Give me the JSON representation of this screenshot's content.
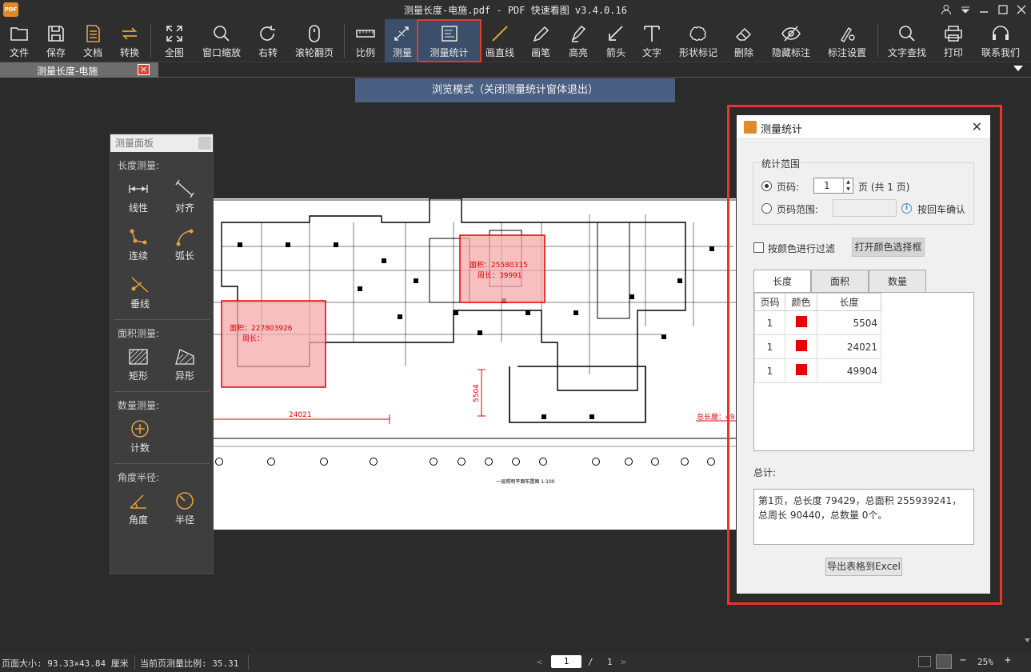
{
  "window": {
    "title": "测量长度-电施.pdf - PDF 快速看图 v3.4.0.16",
    "logo_text": "PDF"
  },
  "toolbar": [
    {
      "label": "文件",
      "icon": "folder-icon"
    },
    {
      "label": "保存",
      "icon": "save-icon"
    },
    {
      "label": "文档",
      "icon": "document-icon"
    },
    {
      "label": "转换",
      "icon": "convert-icon"
    },
    {
      "label": "全图",
      "icon": "fullscreen-icon"
    },
    {
      "label": "窗口缩放",
      "icon": "zoom-icon"
    },
    {
      "label": "右转",
      "icon": "rotate-right-icon"
    },
    {
      "label": "滚轮翻页",
      "icon": "mouse-wheel-icon"
    },
    {
      "label": "比例",
      "icon": "ruler-icon"
    },
    {
      "label": "测量",
      "icon": "measure-icon"
    },
    {
      "label": "测量统计",
      "icon": "measure-stats-icon"
    },
    {
      "label": "画直线",
      "icon": "line-icon"
    },
    {
      "label": "画笔",
      "icon": "pen-icon"
    },
    {
      "label": "高亮",
      "icon": "highlighter-icon"
    },
    {
      "label": "箭头",
      "icon": "arrow-icon"
    },
    {
      "label": "文字",
      "icon": "text-icon"
    },
    {
      "label": "形状标记",
      "icon": "cloud-shape-icon"
    },
    {
      "label": "删除",
      "icon": "eraser-icon"
    },
    {
      "label": "隐藏标注",
      "icon": "eye-hide-icon"
    },
    {
      "label": "标注设置",
      "icon": "settings-icon"
    },
    {
      "label": "文字查找",
      "icon": "search-icon"
    },
    {
      "label": "打印",
      "icon": "printer-icon"
    },
    {
      "label": "联系我们",
      "icon": "headset-icon"
    }
  ],
  "tab": {
    "label": "测量长度-电施",
    "close": "×"
  },
  "banner": "浏览模式（关闭测量统计窗体退出）",
  "drawing": {
    "area1": "面积：25580315",
    "perim1": "周长：39991",
    "area2": "面积：227803926",
    "perim2": "周长：",
    "dim1": "24021",
    "dim2": "5504",
    "total_label": "总长度：49",
    "plan_title": "一层照明平面布置图 1:100"
  },
  "measure_panel": {
    "title": "测量面板",
    "sections": [
      {
        "title": "长度测量:",
        "tools": [
          [
            "线性",
            "对齐"
          ],
          [
            "连续",
            "弧长"
          ],
          [
            "垂线"
          ]
        ]
      },
      {
        "title": "面积测量:",
        "tools": [
          [
            "矩形",
            "异形"
          ]
        ]
      },
      {
        "title": "数量测量:",
        "tools": [
          [
            "计数"
          ]
        ]
      },
      {
        "title": "角度半径:",
        "tools": [
          [
            "角度",
            "半径"
          ]
        ]
      }
    ]
  },
  "stats": {
    "title": "测量统计",
    "range_title": "统计范围",
    "page_label": "页码:",
    "page_value": "1",
    "page_suffix": "页  (共 1 页)",
    "range_label": "页码范围:",
    "enter_hint": "按回车确认",
    "color_filter": "按颜色进行过滤",
    "color_btn": "打开颜色选择框",
    "tabs": [
      "长度",
      "面积",
      "数量"
    ],
    "columns": [
      "页码",
      "颜色",
      "长度"
    ],
    "rows": [
      {
        "page": "1",
        "color": "#e60000",
        "value": "5504"
      },
      {
        "page": "1",
        "color": "#e60000",
        "value": "24021"
      },
      {
        "page": "1",
        "color": "#e60000",
        "value": "49904"
      }
    ],
    "total_label": "总计:",
    "total_text": "第1页，总长度 79429，总面积 255939241，总周长 90440，总数量 0个。",
    "export_btn": "导出表格到Excel"
  },
  "status": {
    "page_size": "页面大小: 93.33×43.84 厘米",
    "scale": "当前页测量比例: 35.31",
    "page_current": "1",
    "page_sep": "/",
    "page_total": "1",
    "zoom": "25%"
  }
}
